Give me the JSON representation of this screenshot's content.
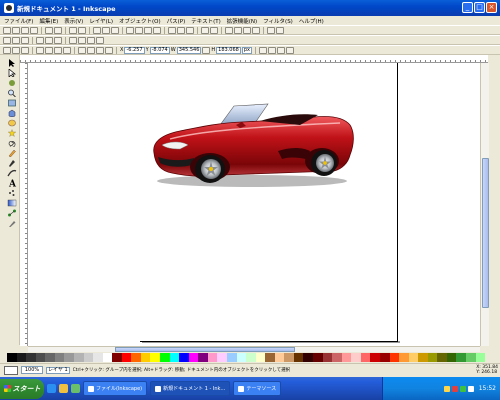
{
  "window": {
    "title": "新規ドキュメント 1 - Inkscape",
    "min": "_",
    "max": "□",
    "close": "×"
  },
  "menu": [
    "ファイル(F)",
    "編集(E)",
    "表示(V)",
    "レイヤ(L)",
    "オブジェクト(O)",
    "パス(P)",
    "テキスト(T)",
    "拡張機能(N)",
    "フィルタ(S)",
    "ヘルプ(H)"
  ],
  "toolbar3": {
    "x_label": "X",
    "x_value": "-6.257",
    "y_label": "Y",
    "y_value": "-8.074",
    "w_label": "W",
    "w_value": "345.546",
    "h_label": "H",
    "h_value": "183.068",
    "unit": "px"
  },
  "status": {
    "layer": "レイヤ 1",
    "message": "Ctrl+クリック: グループ内を選択; Alt+ドラッグ: 移動; ドキュメント内のオブジェクトをクリックして選択",
    "zoom": "100%",
    "x_coord": "X: 351.84",
    "y_coord": "Y: 246.18"
  },
  "taskbar": {
    "start_label": "スタート",
    "tasks": [
      "ファイル(Inkscape)",
      "新規ドキュメント 1 - Ink…",
      "テーマソース"
    ],
    "clock": "15:52"
  },
  "colors": {
    "car_body": "#c01218",
    "taskbar": "#245edb",
    "titlebar": "#0a5fd8"
  },
  "palette": [
    "#000000",
    "#1a1a1a",
    "#333333",
    "#4d4d4d",
    "#666666",
    "#808080",
    "#999999",
    "#b3b3b3",
    "#cccccc",
    "#e6e6e6",
    "#ffffff",
    "#800000",
    "#ff0000",
    "#ff6600",
    "#ffcc00",
    "#ffff00",
    "#00ff00",
    "#00ffff",
    "#0000ff",
    "#ff00ff",
    "#800080",
    "#ff99cc",
    "#ffccff",
    "#99ccff",
    "#ccffff",
    "#ccffcc",
    "#ffffcc",
    "#996633",
    "#ffcc99",
    "#cc9966",
    "#663300",
    "#330000",
    "#660000",
    "#993333",
    "#cc6666",
    "#ff9999",
    "#ffcccc",
    "#ff6666",
    "#cc0000",
    "#990000",
    "#ff3300",
    "#ff9933",
    "#ffcc66",
    "#cc9900",
    "#999900",
    "#666600",
    "#336600",
    "#339933",
    "#66cc66",
    "#99ff99"
  ]
}
